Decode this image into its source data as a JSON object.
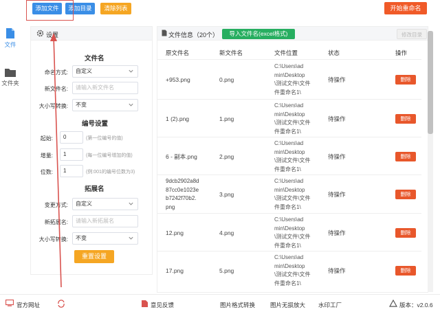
{
  "toolbar": {
    "add_file": "添加文件",
    "add_dir": "添加目录",
    "clear_list": "清除列表",
    "start_rename": "开始重命名"
  },
  "nav": {
    "file": "文件",
    "folder": "文件夹"
  },
  "settings": {
    "title": "设置",
    "filename_section": "文件名",
    "naming_mode_label": "命名方式:",
    "naming_mode_value": "自定义",
    "new_name_label": "新文件名:",
    "new_name_placeholder": "请输入新文件名",
    "case_label": "大小写转换:",
    "case_value": "不变",
    "number_section": "编号设置",
    "start_label": "起始:",
    "start_value": "0",
    "start_hint": "(第一位编号的值)",
    "step_label": "增量:",
    "step_value": "1",
    "step_hint": "(每一位编号增加的值)",
    "digits_label": "位数:",
    "digits_value": "1",
    "digits_hint": "(例:001的编号位数为3)",
    "ext_section": "拓展名",
    "ext_mode_label": "变更方式:",
    "ext_mode_value": "自定义",
    "new_ext_label": "新拓展名:",
    "new_ext_placeholder": "请输入新拓展名",
    "ext_case_label": "大小写转换:",
    "ext_case_value": "不变",
    "reset": "重置设置"
  },
  "files": {
    "title": "文件信息（20个）",
    "import": "导入文件名(excel格式)",
    "change_dir": "修改目录",
    "columns": [
      "原文件名",
      "新文件名",
      "文件位置",
      "状态",
      "操作"
    ],
    "rows": [
      {
        "orig": "+953.png",
        "new": "0.png",
        "loc": [
          "C:\\Users\\ad",
          "min\\Desktop",
          "\\测试文件\\文件",
          "件重命名1\\"
        ],
        "status": "待操作",
        "action": "删除"
      },
      {
        "orig": "1 (2).png",
        "new": "1.png",
        "loc": [
          "C:\\Users\\ad",
          "min\\Desktop",
          "\\测试文件\\文件",
          "件重命名1\\"
        ],
        "status": "待操作",
        "action": "删除"
      },
      {
        "orig": "6 - 副本.png",
        "new": "2.png",
        "loc": [
          "C:\\Users\\ad",
          "min\\Desktop",
          "\\测试文件\\文件",
          "件重命名1\\"
        ],
        "status": "待操作",
        "action": "删除"
      },
      {
        "orig": [
          "9dcb2902a8d",
          "87cc0e1023e",
          "b7242f70b2.",
          "png"
        ],
        "new": "3.png",
        "loc": [
          "C:\\Users\\ad",
          "min\\Desktop",
          "\\测试文件\\文件",
          "件重命名1\\"
        ],
        "status": "待操作",
        "action": "删除"
      },
      {
        "orig": "12.png",
        "new": "4.png",
        "loc": [
          "C:\\Users\\ad",
          "min\\Desktop",
          "\\测试文件\\文件",
          "件重命名1\\"
        ],
        "status": "待操作",
        "action": "删除"
      },
      {
        "orig": "17.png",
        "new": "5.png",
        "loc": [
          "C:\\Users\\ad",
          "min\\Desktop",
          "\\测试文件\\文件",
          "件重命名1\\"
        ],
        "status": "待操作",
        "action": "删除"
      }
    ]
  },
  "footer": {
    "website": "官方网址",
    "feedback": "意见反馈",
    "format_convert": "图片格式转换",
    "lossless_zoom": "图片无损放大",
    "watermark": "水印工厂",
    "version": "版本：v2.0.6"
  },
  "colors": {
    "primary": "#3a8ee6",
    "warning": "#f5a623",
    "danger": "#e8572b",
    "success": "#27ae60"
  }
}
